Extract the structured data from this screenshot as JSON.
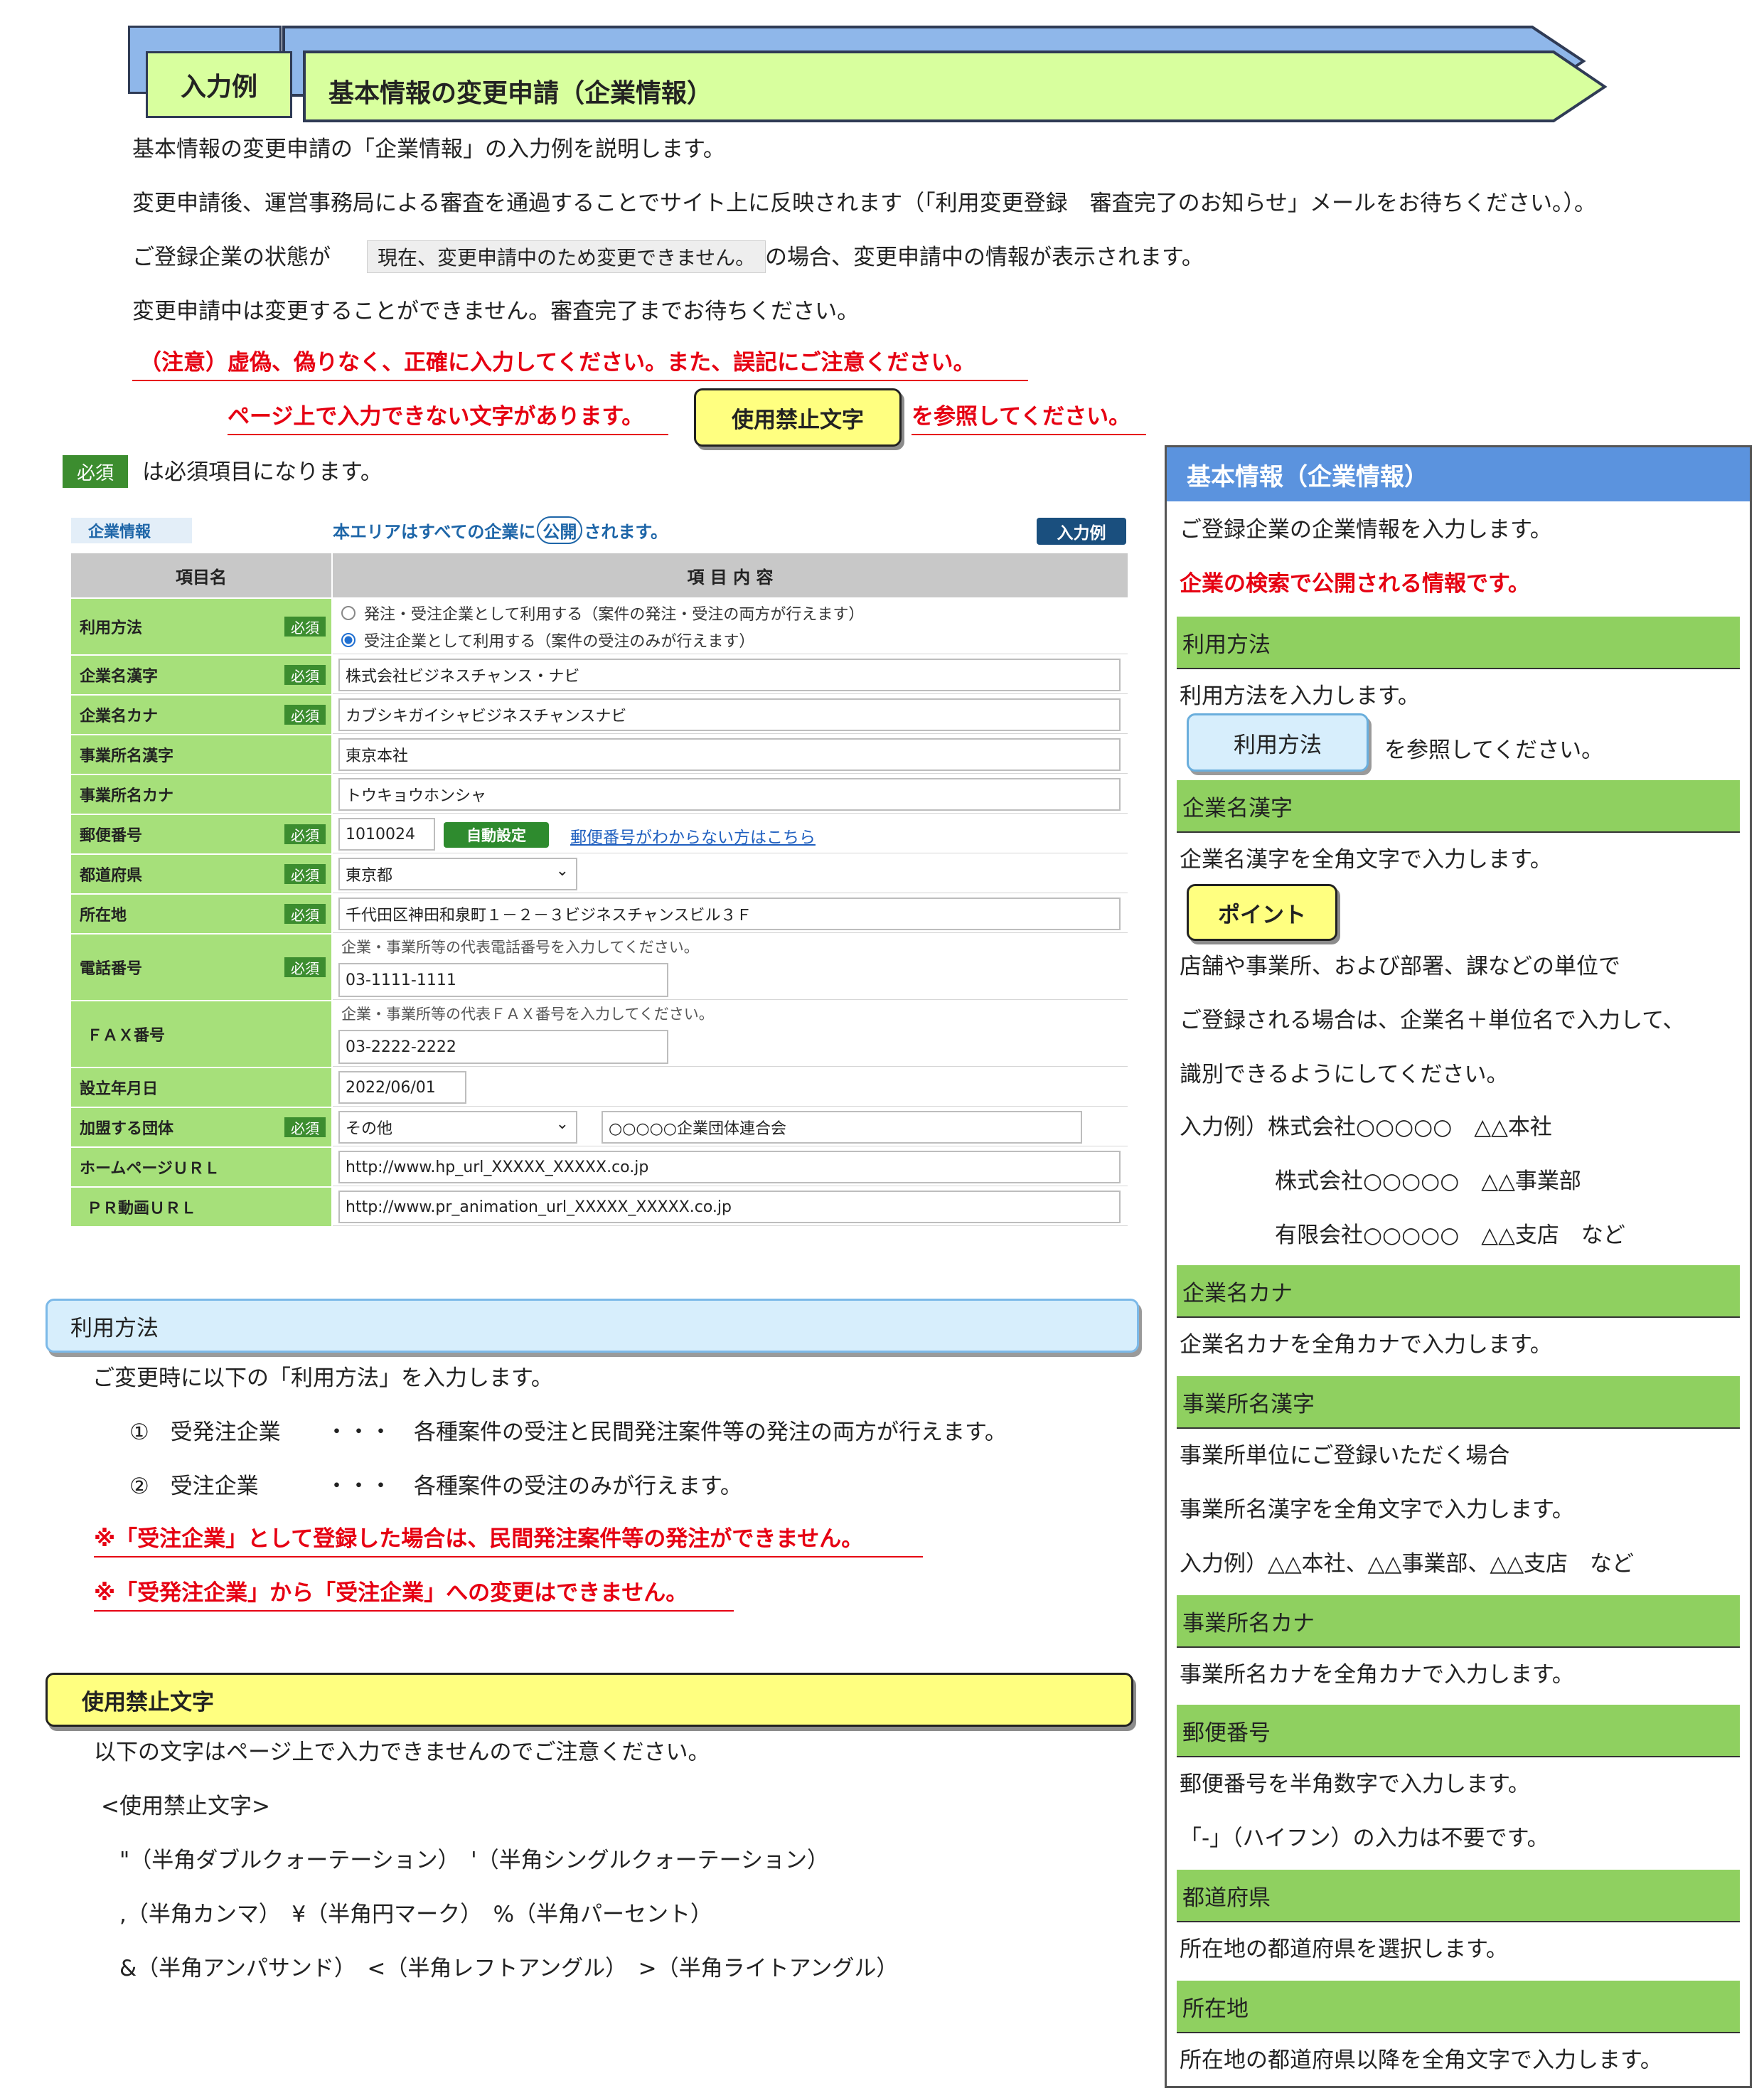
{
  "header": {
    "tag": "入力例",
    "title": "基本情報の変更申請（企業情報）"
  },
  "intro": {
    "line1": "基本情報の変更申請の「企業情報」の入力例を説明します。",
    "line2": "変更申請後、運営事務局による審査を通過することでサイト上に反映されます（「利用変更登録　審査完了のお知らせ」メールをお待ちください。）。",
    "line3_pre": "ご登録企業の状態が",
    "status_chip": "現在、変更申請中のため変更できません。",
    "line3_post": "の場合、変更申請中の情報が表示されます。",
    "line4": "変更申請中は変更することができません。審査完了までお待ちください。",
    "warn1": "（注意）虚偽、偽りなく、正確に入力してください。また、誤記にご注意ください。",
    "warn2_pre": "ページ上で入力できない文字があります。",
    "warn2_button": "使用禁止文字",
    "warn2_post": "を参照してください。",
    "required_badge": "必須",
    "required_text": "は必須項目になります。"
  },
  "form": {
    "section_label": "企業情報",
    "public_note_pre": "本エリアはすべての企業に",
    "public_badge": "公開",
    "public_note_post": "されます。",
    "example_badge": "入力例",
    "col_item": "項目名",
    "col_content": "項 目 内 容",
    "required_badge": "必須",
    "usage_label": "利用方法",
    "usage_option1": "発注・受注企業として利用する（案件の発注・受注の両方が行えます）",
    "usage_option2": "受注企業として利用する（案件の受注のみが行えます）",
    "name_kanji_label": "企業名漢字",
    "name_kanji_value": "株式会社ビジネスチャンス・ナビ",
    "name_kana_label": "企業名カナ",
    "name_kana_value": "カブシキガイシャビジネスチャンスナビ",
    "office_kanji_label": "事業所名漢字",
    "office_kanji_value": "東京本社",
    "office_kana_label": "事業所名カナ",
    "office_kana_value": "トウキョウホンシャ",
    "postal_label": "郵便番号",
    "postal_value": "1010024",
    "postal_button": "自動設定",
    "postal_link": "郵便番号がわからない方はこちら",
    "pref_label": "都道府県",
    "pref_value": "東京都",
    "address_label": "所在地",
    "address_value": "千代田区神田和泉町１－２－３ビジネスチャンスビル３Ｆ",
    "tel_label": "電話番号",
    "tel_note": "企業・事業所等の代表電話番号を入力してください。",
    "tel_value": "03-1111-1111",
    "fax_label": "ＦＡＸ番号",
    "fax_note": "企業・事業所等の代表ＦＡＸ番号を入力してください。",
    "fax_value": "03-2222-2222",
    "founded_label": "設立年月日",
    "founded_value": "2022/06/01",
    "group_label": "加盟する団体",
    "group_select": "その他",
    "group_value": "○○○○○企業団体連合会",
    "hp_label": "ホームページＵＲＬ",
    "hp_value": "http://www.hp_url_XXXXX_XXXXX.co.jp",
    "pr_label": "ＰＲ動画ＵＲＬ",
    "pr_value": "http://www.pr_animation_url_XXXXX_XXXXX.co.jp"
  },
  "usage_section": {
    "title": "利用方法",
    "line1": "ご変更時に以下の「利用方法」を入力します。",
    "item1_num": "①",
    "item1_name": "受発注企業",
    "item1_dots": "・・・",
    "item1_desc": "各種案件の受注と民間発注案件等の発注の両方が行えます。",
    "item2_num": "②",
    "item2_name": "受注企業",
    "item2_dots": "・・・",
    "item2_desc": "各種案件の受注のみが行えます。",
    "warn1": "※「受注企業」として登録した場合は、民間発注案件等の発注ができません。",
    "warn2": "※「受発注企業」から「受注企業」への変更はできません。"
  },
  "forbidden_section": {
    "title": "使用禁止文字",
    "line1": "以下の文字はページ上で入力できませんのでご注意ください。",
    "line2": "<使用禁止文字>",
    "line3": "\"（半角ダブルクォーテーション）　'（半角シングルクォーテーション）",
    "line4": ",（半角カンマ）　¥（半角円マーク）　%（半角パーセント）",
    "line5": "&（半角アンパサンド）　<（半角レフトアングル）　>（半角ライトアングル）"
  },
  "right_panel": {
    "title": "基本情報（企業情報）",
    "intro": "ご登録企業の企業情報を入力します。",
    "intro_red": "企業の検索で公開される情報です。",
    "usage_bar": "利用方法",
    "usage_text": "利用方法を入力します。",
    "usage_button": "利用方法",
    "usage_after": "を参照してください。",
    "name_kanji_bar": "企業名漢字",
    "name_kanji_text": "企業名漢字を全角文字で入力します。",
    "point_button": "ポイント",
    "point1": "店舗や事業所、および部署、課などの単位で",
    "point2": "ご登録される場合は、企業名＋単位名で入力して、",
    "point3": "識別できるようにしてください。",
    "ex1": "入力例）株式会社○○○○○　△△本社",
    "ex2": "株式会社○○○○○　△△事業部",
    "ex3": "有限会社○○○○○　△△支店　など",
    "name_kana_bar": "企業名カナ",
    "name_kana_text": "企業名カナを全角カナで入力します。",
    "office_kanji_bar": "事業所名漢字",
    "office_kanji_text1": "事業所単位にご登録いただく場合",
    "office_kanji_text2": "事業所名漢字を全角文字で入力します。",
    "office_kanji_text3": "入力例）△△本社、△△事業部、△△支店　など",
    "office_kana_bar": "事業所名カナ",
    "office_kana_text": "事業所名カナを全角カナで入力します。",
    "postal_bar": "郵便番号",
    "postal_text1": "郵便番号を半角数字で入力します。",
    "postal_text2": "「-」（ハイフン）の入力は不要です。",
    "pref_bar": "都道府県",
    "pref_text": "所在地の都道府県を選択します。",
    "address_bar": "所在地",
    "address_text": "所在地の都道府県以降を全角文字で入力します。"
  }
}
